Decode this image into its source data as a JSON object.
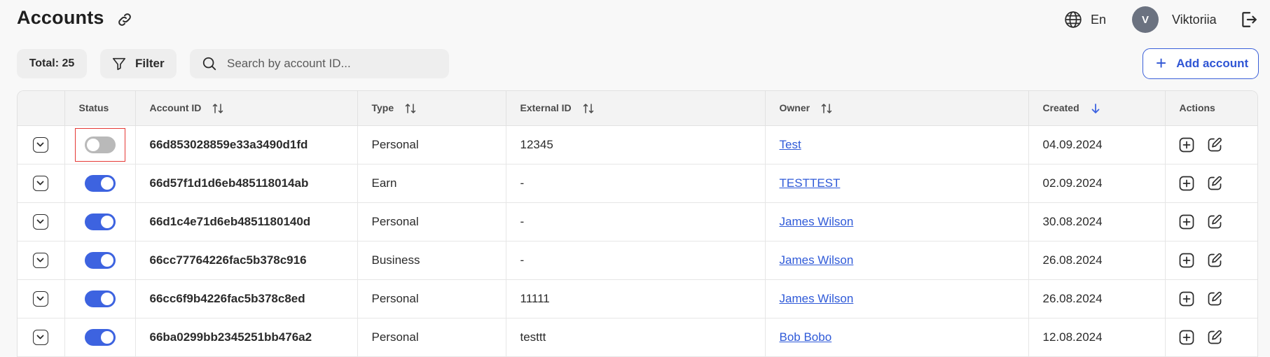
{
  "header": {
    "title": "Accounts",
    "language": "En",
    "user_initial": "V",
    "user_name": "Viktoriia"
  },
  "toolbar": {
    "total_label": "Total: 25",
    "filter_label": "Filter",
    "search_placeholder": "Search by account ID...",
    "add_label": "Add account"
  },
  "table": {
    "columns": {
      "status": "Status",
      "account_id": "Account ID",
      "type": "Type",
      "external_id": "External ID",
      "owner": "Owner",
      "created": "Created",
      "actions": "Actions"
    },
    "rows": [
      {
        "status_on": false,
        "account_id": "66d853028859e33a3490d1fd",
        "type": "Personal",
        "external_id": "12345",
        "owner": "Test",
        "created": "04.09.2024"
      },
      {
        "status_on": true,
        "account_id": "66d57f1d1d6eb485118014ab",
        "type": "Earn",
        "external_id": "-",
        "owner": "TESTTEST",
        "created": "02.09.2024"
      },
      {
        "status_on": true,
        "account_id": "66d1c4e71d6eb4851180140d",
        "type": "Personal",
        "external_id": "-",
        "owner": "James Wilson",
        "created": "30.08.2024"
      },
      {
        "status_on": true,
        "account_id": "66cc77764226fac5b378c916",
        "type": "Business",
        "external_id": "-",
        "owner": "James Wilson",
        "created": "26.08.2024"
      },
      {
        "status_on": true,
        "account_id": "66cc6f9b4226fac5b378c8ed",
        "type": "Personal",
        "external_id": "11111",
        "owner": "James Wilson",
        "created": "26.08.2024"
      },
      {
        "status_on": true,
        "account_id": "66ba0299bb2345251bb476a2",
        "type": "Personal",
        "external_id": "testtt",
        "owner": "Bob Bobo",
        "created": "12.08.2024"
      }
    ]
  },
  "colors": {
    "accent": "#3d63e0",
    "toggle_off": "#b9b9b9",
    "highlight": "#e53935",
    "link": "#2f5ad8"
  },
  "icons": {
    "title_link": "link-icon",
    "language": "globe-icon",
    "logout": "logout-icon",
    "filter": "filter-icon",
    "search": "search-icon",
    "sort": "sort-icon",
    "sort_desc": "arrow-down-icon",
    "expand": "chevron-down-icon",
    "add_row": "plus-square-icon",
    "edit_row": "edit-icon"
  }
}
